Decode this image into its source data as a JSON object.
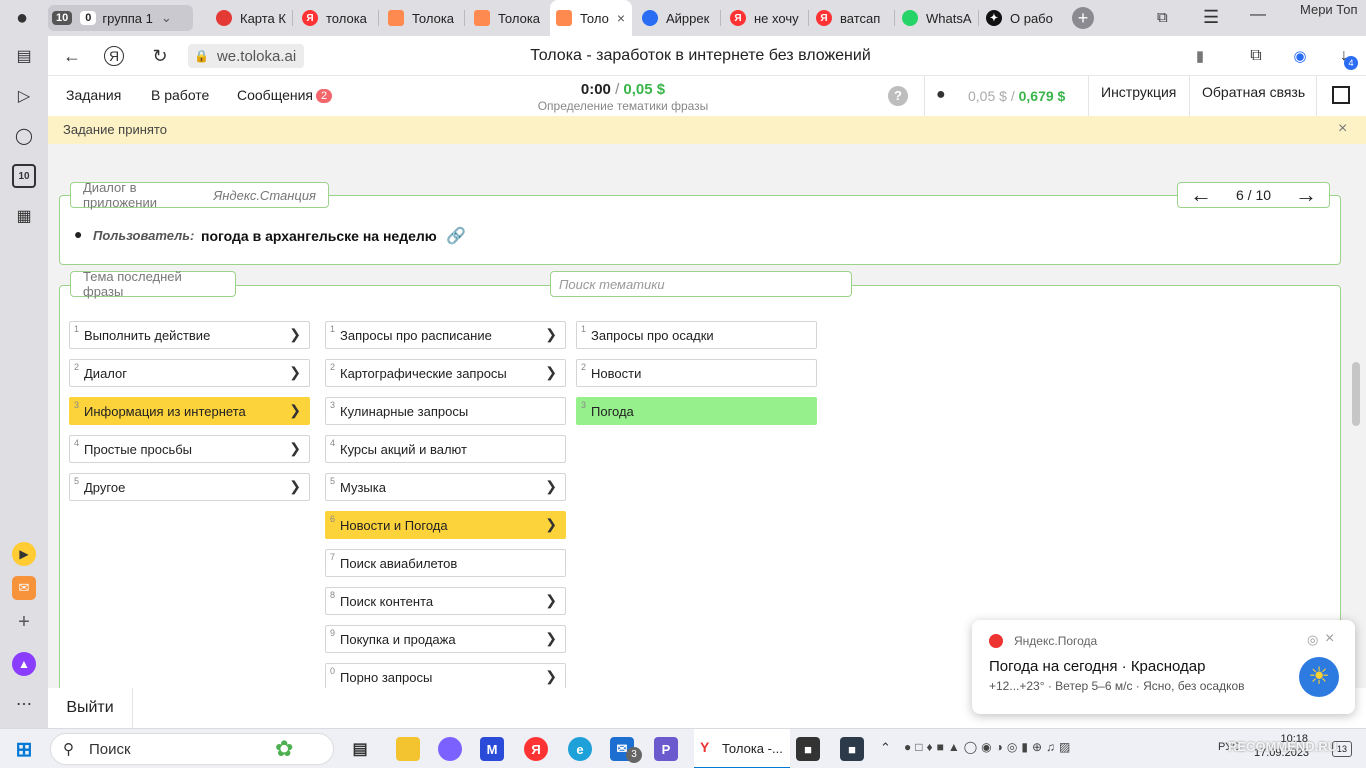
{
  "tabs": {
    "group_count": "10",
    "group_badge": "0",
    "group_name": "группа 1",
    "items": [
      {
        "label": "Карта К",
        "color": "#e53935"
      },
      {
        "label": "толока",
        "color": "#f33"
      },
      {
        "label": "Толока",
        "color": "#ff8a50"
      },
      {
        "label": "Толока",
        "color": "#ff8a50"
      },
      {
        "label": "Толо",
        "color": "#ff8a50"
      },
      {
        "label": "Айррек",
        "color": "#2a6df4"
      },
      {
        "label": "не хочу",
        "color": "#f33"
      },
      {
        "label": "ватсап",
        "color": "#f33"
      },
      {
        "label": "WhatsA",
        "color": "#25d366"
      },
      {
        "label": "О рабо",
        "color": "#111"
      }
    ],
    "profile": "Мери Топ"
  },
  "sidebar": {
    "badge": "10"
  },
  "address": {
    "url": "we.toloka.ai",
    "title": "Толока - заработок в интернете без вложений",
    "downloads": "4"
  },
  "header": {
    "nav_tasks": "Задания",
    "nav_inwork": "В работе",
    "nav_messages": "Сообщения",
    "messages_count": "2",
    "timer": "0:00",
    "timer_sep": "/",
    "timer_reward": "0,05 $",
    "task_name": "Определение тематики фразы",
    "help": "?",
    "balance_pending": "0,05 $",
    "balance_sep": "/",
    "balance_total": "0,679 $",
    "instruction": "Инструкция",
    "feedback": "Обратная связь"
  },
  "banner": {
    "text": "Задание принято",
    "close": "×"
  },
  "dialog": {
    "legend_prefix": "Диалог в приложении",
    "legend_app": "Яндекс.Станция",
    "page": "6 / 10",
    "speaker": "Пользователь:",
    "phrase": "погода в архангельске на неделю"
  },
  "topics": {
    "legend": "Тема последней фразы",
    "search_placeholder": "Поиск тематики",
    "col1": [
      {
        "n": "1",
        "label": "Выполнить действие"
      },
      {
        "n": "2",
        "label": "Диалог"
      },
      {
        "n": "3",
        "label": "Информация из интернета"
      },
      {
        "n": "4",
        "label": "Простые просьбы"
      },
      {
        "n": "5",
        "label": "Другое"
      }
    ],
    "col2": [
      {
        "n": "1",
        "label": "Запросы про расписание"
      },
      {
        "n": "2",
        "label": "Картографические запросы"
      },
      {
        "n": "3",
        "label": "Кулинарные запросы"
      },
      {
        "n": "4",
        "label": "Курсы акций и валют"
      },
      {
        "n": "5",
        "label": "Музыка"
      },
      {
        "n": "6",
        "label": "Новости и Погода"
      },
      {
        "n": "7",
        "label": "Поиск авиабилетов"
      },
      {
        "n": "8",
        "label": "Поиск контента"
      },
      {
        "n": "9",
        "label": "Покупка и продажа"
      },
      {
        "n": "0",
        "label": "Порно запросы"
      }
    ],
    "col3": [
      {
        "n": "1",
        "label": "Запросы про осадки"
      },
      {
        "n": "2",
        "label": "Новости"
      },
      {
        "n": "3",
        "label": "Погода"
      }
    ]
  },
  "footer": {
    "exit": "Выйти"
  },
  "notification": {
    "app": "Яндекс.Погода",
    "title": "Погода на сегодня · Краснодар",
    "body": "+12...+23° · Ветер 5–6 м/с · Ясно, без осадков"
  },
  "taskbar": {
    "search": "Поиск",
    "mail_badge": "3",
    "active_app": "Толока -...",
    "time": "10:18",
    "date": "17.09.2023",
    "lang": "РУС",
    "notif_count": "13",
    "watermark": "RECOMMEND.RU"
  }
}
